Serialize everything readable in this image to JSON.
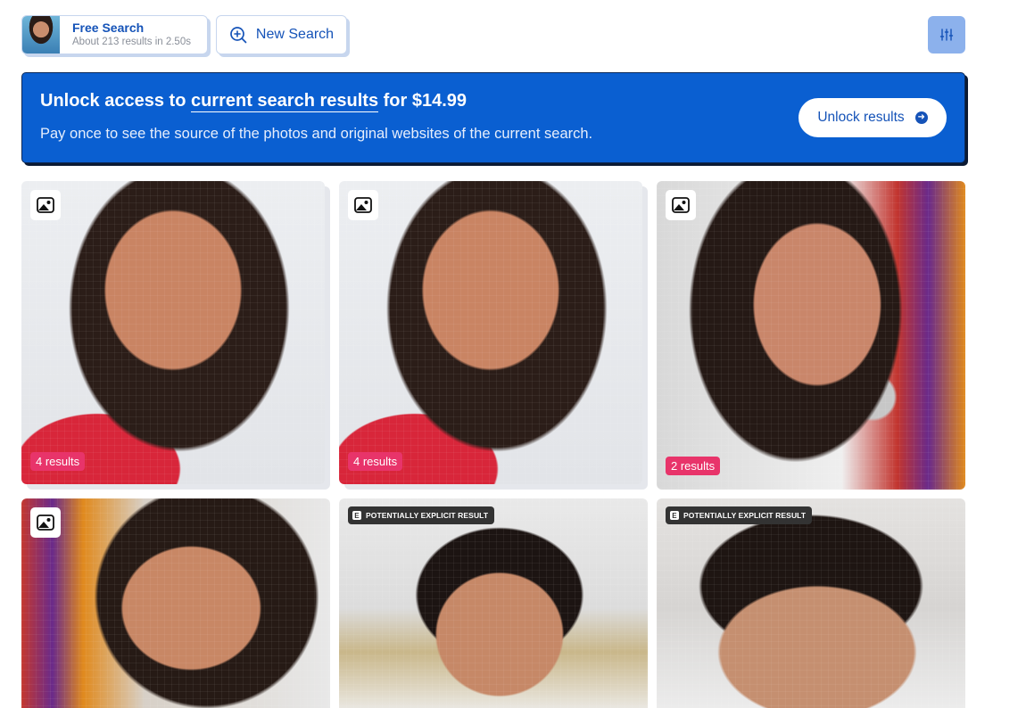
{
  "search_chip": {
    "title": "Free Search",
    "subtitle": "About 213 results in 2.50s"
  },
  "new_search": {
    "label": "New Search",
    "icon": "magnifier-plus-icon"
  },
  "filter": {
    "icon": "sliders-icon"
  },
  "banner": {
    "title_prefix": "Unlock access to ",
    "title_link": "current search results",
    "title_suffix": " for $14.99",
    "subtitle": "Pay once to see the source of the photos and original websites of the current search.",
    "button_label": "Unlock results",
    "button_icon": "arrow-right-circle-icon"
  },
  "results": [
    {
      "kind": "image",
      "count_label": "4 results"
    },
    {
      "kind": "image",
      "count_label": "4 results"
    },
    {
      "kind": "image",
      "count_label": "2 results"
    },
    {
      "kind": "image",
      "count_label": ""
    },
    {
      "kind": "explicit",
      "badge_label": "POTENTIALLY EXPLICIT RESULT",
      "badge_letter": "E"
    },
    {
      "kind": "explicit",
      "badge_label": "POTENTIALLY EXPLICIT RESULT",
      "badge_letter": "E"
    }
  ],
  "colors": {
    "brand_blue": "#1553b8",
    "banner_blue": "#0a5fd1",
    "count_badge": "#e8346a",
    "filter_button": "#8cb1ec"
  }
}
